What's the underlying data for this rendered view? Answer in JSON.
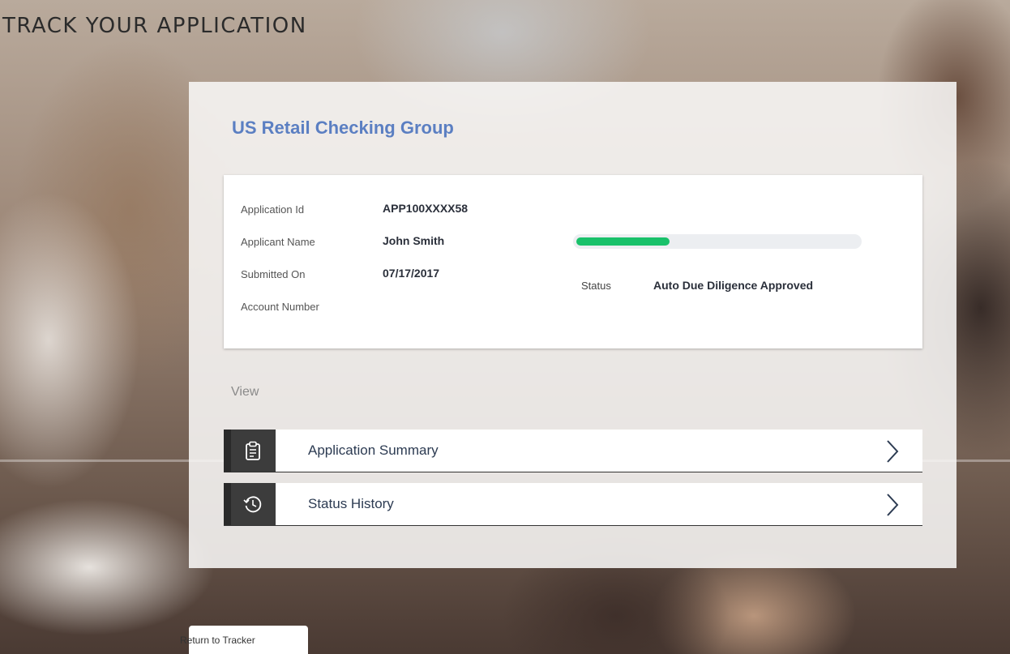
{
  "page": {
    "title": "TRACK YOUR APPLICATION"
  },
  "application": {
    "product_name": "US Retail Checking Group",
    "fields": [
      {
        "label": "Application Id",
        "value": "APP100XXXX58"
      },
      {
        "label": "Applicant Name",
        "value": "John Smith"
      },
      {
        "label": "Submitted On",
        "value": "07/17/2017"
      },
      {
        "label": "Account Number",
        "value": ""
      }
    ],
    "status_label": "Status",
    "status_value": "Auto Due Diligence Approved",
    "progress_fraction": 0.33
  },
  "view": {
    "heading": "View",
    "items": [
      {
        "label": "Application Summary",
        "icon": "clipboard-icon"
      },
      {
        "label": "Status History",
        "icon": "history-clock-icon"
      }
    ]
  },
  "footer": {
    "return_label": "Return to Tracker"
  },
  "colors": {
    "accent_title": "#5b7fc2",
    "progress": "#19c16a",
    "icon_box": "#3c3c3c"
  }
}
